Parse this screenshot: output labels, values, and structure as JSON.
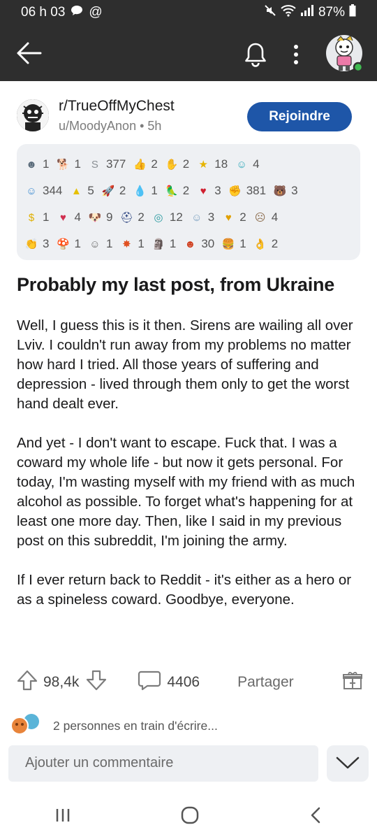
{
  "status": {
    "time": "06 h 03",
    "battery": "87%"
  },
  "post": {
    "subreddit": "r/TrueOffMyChest",
    "author": "u/MoodyAnon",
    "age": "5h",
    "separator": "•",
    "join_label": "Rejoindre",
    "title": "Probably my last post, from Ukraine",
    "paragraphs": [
      "Well, I guess this is it then. Sirens are wailing all over Lviv. I couldn't run away from my problems no matter how hard I tried. All those years of suffering and depression - lived through them only to get the worst hand dealt ever.",
      "And yet - I don't want to escape. Fuck that. I was a coward my whole life - but now it gets personal. For today, I'm wasting myself with my friend with as much alcohol as possible. To forget what's happening for at least one more day. Then, like I said in my previous post on this subreddit, I'm joining the army.",
      "If I ever return back to Reddit - it's either as a hero or as a spineless coward. Goodbye, everyone."
    ]
  },
  "awards": {
    "rows": [
      [
        {
          "icon": "snoo-face-award-icon",
          "glyph": "☻",
          "color": "#5a6b7a",
          "count": "1"
        },
        {
          "icon": "dog-award-icon",
          "glyph": "🐕",
          "color": "#c47a3a",
          "count": "1"
        },
        {
          "icon": "silver-award-icon",
          "glyph": "S",
          "color": "#8a8f94",
          "count": "377"
        },
        {
          "icon": "thumbs-fire-award-icon",
          "glyph": "👍",
          "color": "#f0a020",
          "count": "2"
        },
        {
          "icon": "hands-award-icon",
          "glyph": "✋",
          "color": "#6a6a6a",
          "count": "2"
        },
        {
          "icon": "gold-award-icon",
          "glyph": "★",
          "color": "#e6b400",
          "count": "18"
        },
        {
          "icon": "wholesome-award-icon",
          "glyph": "☺",
          "color": "#2aa6b8",
          "count": "4"
        }
      ],
      [
        {
          "icon": "helpful-award-icon",
          "glyph": "☺",
          "color": "#3a8ad0",
          "count": "344"
        },
        {
          "icon": "warning-award-icon",
          "glyph": "▲",
          "color": "#e6c000",
          "count": "5"
        },
        {
          "icon": "rocket-award-icon",
          "glyph": "🚀",
          "color": "#d04040",
          "count": "2"
        },
        {
          "icon": "tear-award-icon",
          "glyph": "💧",
          "color": "#6a9ac0",
          "count": "1"
        },
        {
          "icon": "parrot-award-icon",
          "glyph": "🦜",
          "color": "#c0a020",
          "count": "2"
        },
        {
          "icon": "heart-award-icon",
          "glyph": "♥",
          "color": "#d02030",
          "count": "3"
        },
        {
          "icon": "table-slap-award-icon",
          "glyph": "✊",
          "color": "#7a7a7a",
          "count": "381"
        },
        {
          "icon": "bear-award-icon",
          "glyph": "🐻",
          "color": "#8a5a2a",
          "count": "3"
        }
      ],
      [
        {
          "icon": "money-award-icon",
          "glyph": "$",
          "color": "#e0b000",
          "count": "1"
        },
        {
          "icon": "heart-eyes-award-icon",
          "glyph": "♥",
          "color": "#d03050",
          "count": "4"
        },
        {
          "icon": "pup-award-icon",
          "glyph": "🐶",
          "color": "#a06040",
          "count": "9"
        },
        {
          "icon": "helmet-award-icon",
          "glyph": "⛑",
          "color": "#203a7a",
          "count": "2"
        },
        {
          "icon": "globe-award-icon",
          "glyph": "◎",
          "color": "#2a9aa0",
          "count": "12"
        },
        {
          "icon": "angel-award-icon",
          "glyph": "☺",
          "color": "#7aa0c0",
          "count": "3"
        },
        {
          "icon": "gold-heart-award-icon",
          "glyph": "♥",
          "color": "#e0a000",
          "count": "2"
        },
        {
          "icon": "facepalm-award-icon",
          "glyph": "☹",
          "color": "#8a6a4a",
          "count": "4"
        }
      ],
      [
        {
          "icon": "clap-award-icon",
          "glyph": "👏",
          "color": "#e0b000",
          "count": "3"
        },
        {
          "icon": "mushroom-award-icon",
          "glyph": "🍄",
          "color": "#9a6a4a",
          "count": "1"
        },
        {
          "icon": "blush-award-icon",
          "glyph": "☺",
          "color": "#6a6a6a",
          "count": "1"
        },
        {
          "icon": "spark-award-icon",
          "glyph": "✸",
          "color": "#e05020",
          "count": "1"
        },
        {
          "icon": "moai-award-icon",
          "glyph": "🗿",
          "color": "#6a7070",
          "count": "1"
        },
        {
          "icon": "snoo-award-icon",
          "glyph": "☻",
          "color": "#d04020",
          "count": "30"
        },
        {
          "icon": "burger-award-icon",
          "glyph": "🍔",
          "color": "#c07020",
          "count": "1"
        },
        {
          "icon": "ok-hand-award-icon",
          "glyph": "👌",
          "color": "#c09060",
          "count": "2"
        }
      ]
    ]
  },
  "actions": {
    "upvotes": "98,4k",
    "comments": "4406",
    "share_label": "Partager"
  },
  "typing": {
    "text": "2 personnes en train d'écrire..."
  },
  "composer": {
    "placeholder": "Ajouter un commentaire"
  },
  "colors": {
    "header_bg": "#2e2e2e",
    "accent": "#1e56a8",
    "online_dot": "#3fb950"
  }
}
